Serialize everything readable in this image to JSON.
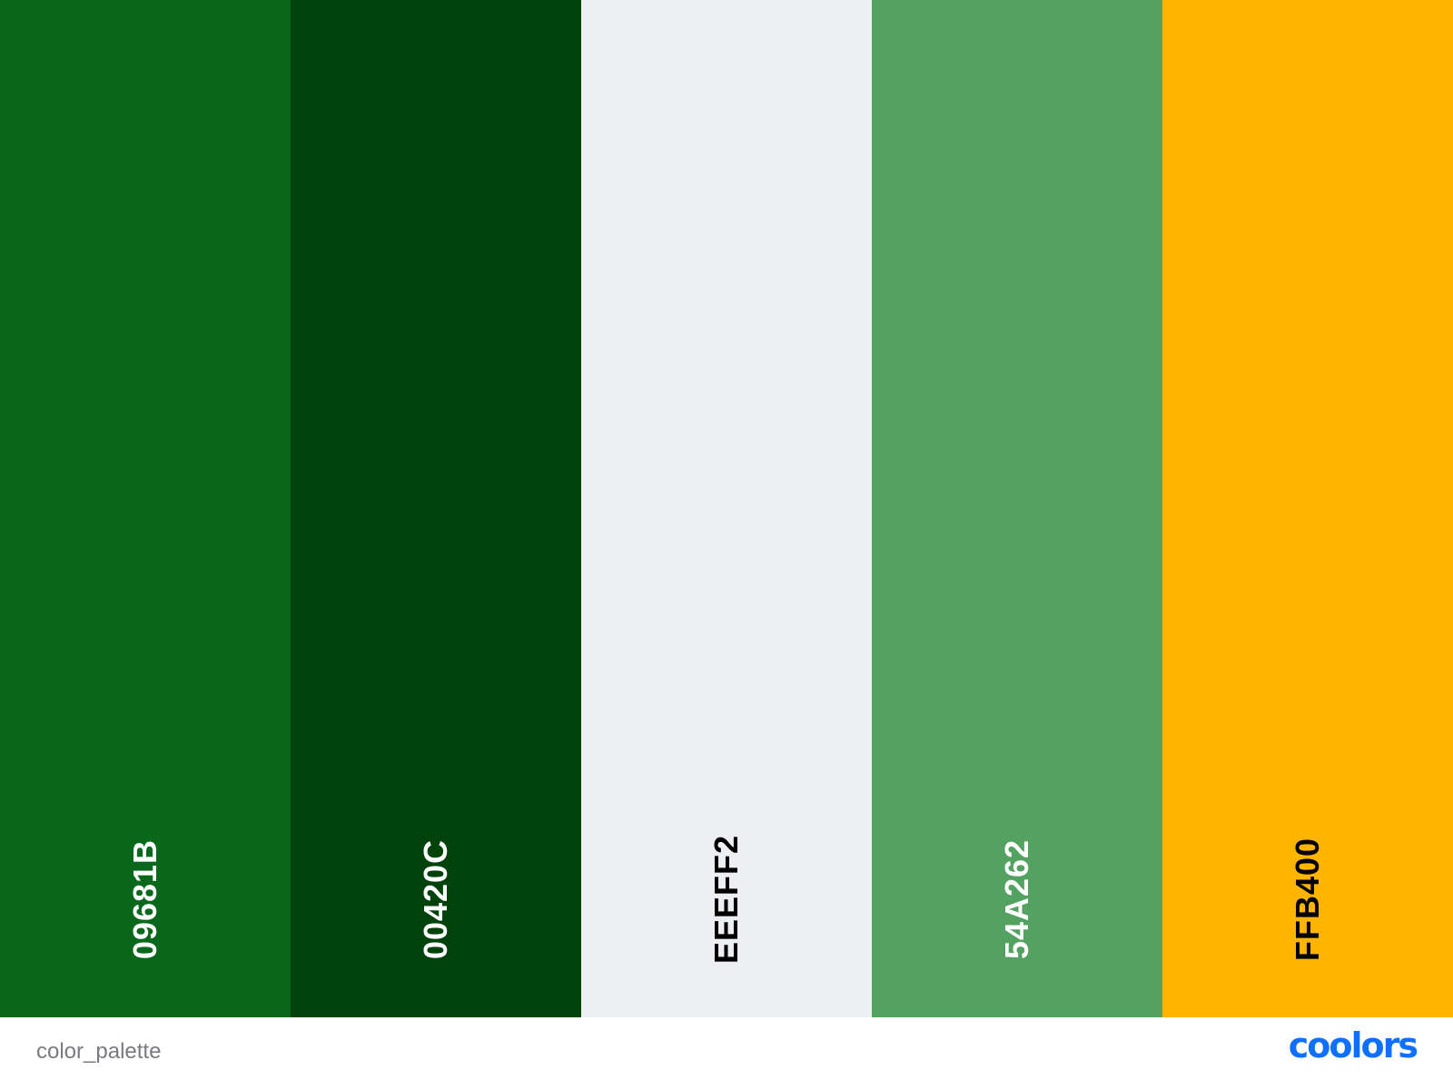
{
  "palette": {
    "swatches": [
      {
        "hex": "09681B",
        "color": "#09681B",
        "text_color": "#ffffff"
      },
      {
        "hex": "00420C",
        "color": "#00420C",
        "text_color": "#ffffff"
      },
      {
        "hex": "EEEFF2",
        "color": "#EEEFF2",
        "text_color": "#000000"
      },
      {
        "hex": "54A262",
        "color": "#54A262",
        "text_color": "#ffffff"
      },
      {
        "hex": "FFB400",
        "color": "#FFB400",
        "text_color": "#000000"
      }
    ]
  },
  "footer": {
    "palette_name": "color_palette",
    "brand": "coolors",
    "brand_color": "#0F6FFF"
  }
}
